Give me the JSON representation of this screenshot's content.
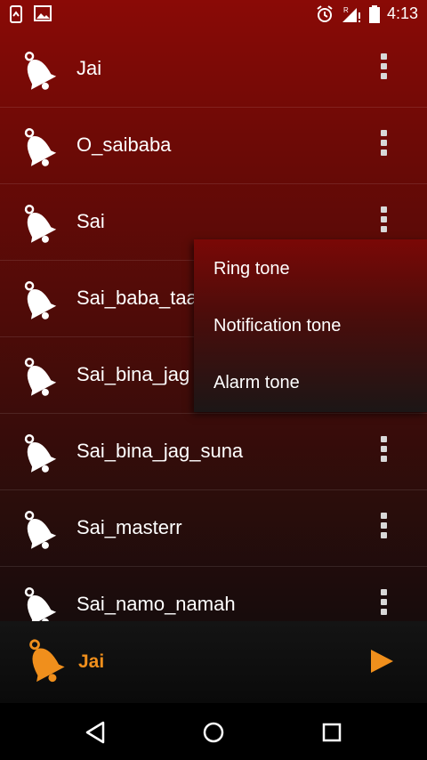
{
  "status_bar": {
    "time": "4:13",
    "left_icons": [
      "phone-sync-icon",
      "image-icon"
    ],
    "right_icons": [
      "alarm-icon",
      "signal-roaming-icon",
      "battery-icon"
    ]
  },
  "ringtones": [
    {
      "label": "Jai"
    },
    {
      "label": "O_saibaba"
    },
    {
      "label": "Sai"
    },
    {
      "label": "Sai_baba_taa"
    },
    {
      "label": "Sai_bina_jag"
    },
    {
      "label": "Sai_bina_jag_suna"
    },
    {
      "label": "Sai_masterr"
    },
    {
      "label": "Sai_namo_namah"
    }
  ],
  "context_menu": {
    "items": [
      "Ring tone",
      "Notification tone",
      "Alarm tone"
    ]
  },
  "player": {
    "current_title": "Jai"
  },
  "colors": {
    "accent": "#f08f1c",
    "header_red": "#8a0a06"
  }
}
